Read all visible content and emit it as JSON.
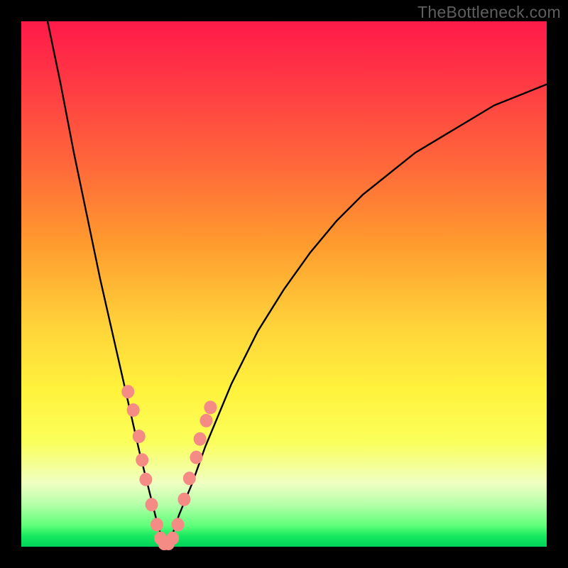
{
  "watermark": "TheBottleneck.com",
  "colors": {
    "frame": "#000000",
    "curve": "#000000",
    "marker_fill": "#f58b85",
    "marker_stroke": "#e46a64"
  },
  "chart_data": {
    "type": "line",
    "title": "",
    "xlabel": "",
    "ylabel": "",
    "xlim": [
      0,
      100
    ],
    "ylim": [
      0,
      100
    ],
    "grid": false,
    "legend": false,
    "curve": {
      "description": "V-shaped bottleneck curve; y is percent mismatch (100=max, 0=optimal) vs x (generic scale 0..100). Minimum near x≈27.5.",
      "x": [
        5,
        7.5,
        10,
        12.5,
        15,
        17.5,
        20,
        22.5,
        25,
        26,
        27,
        27.5,
        28,
        29,
        30,
        32.5,
        35,
        37.5,
        40,
        45,
        50,
        55,
        60,
        65,
        70,
        75,
        80,
        85,
        90,
        95,
        100
      ],
      "y": [
        100,
        88,
        75,
        63,
        51,
        40,
        29,
        18,
        8,
        4,
        1,
        0,
        1,
        3,
        6,
        12,
        19,
        25,
        31,
        41,
        49,
        56,
        62,
        67,
        71,
        75,
        78,
        81,
        84,
        86,
        88
      ]
    },
    "markers": {
      "description": "Highlighted data points (pink dots) clustered near the curve's bottom on both sides.",
      "points": [
        {
          "x": 20.3,
          "y": 29.5
        },
        {
          "x": 21.3,
          "y": 26.0
        },
        {
          "x": 22.4,
          "y": 21.0
        },
        {
          "x": 23.0,
          "y": 16.5
        },
        {
          "x": 23.7,
          "y": 12.8
        },
        {
          "x": 24.8,
          "y": 8.0
        },
        {
          "x": 25.8,
          "y": 4.2
        },
        {
          "x": 26.5,
          "y": 1.6
        },
        {
          "x": 27.2,
          "y": 0.6
        },
        {
          "x": 28.0,
          "y": 0.6
        },
        {
          "x": 28.8,
          "y": 1.6
        },
        {
          "x": 29.8,
          "y": 4.2
        },
        {
          "x": 31.0,
          "y": 9.0
        },
        {
          "x": 32.0,
          "y": 13.0
        },
        {
          "x": 33.3,
          "y": 17.0
        },
        {
          "x": 34.0,
          "y": 20.5
        },
        {
          "x": 35.2,
          "y": 24.0
        },
        {
          "x": 36.0,
          "y": 26.5
        }
      ]
    }
  }
}
